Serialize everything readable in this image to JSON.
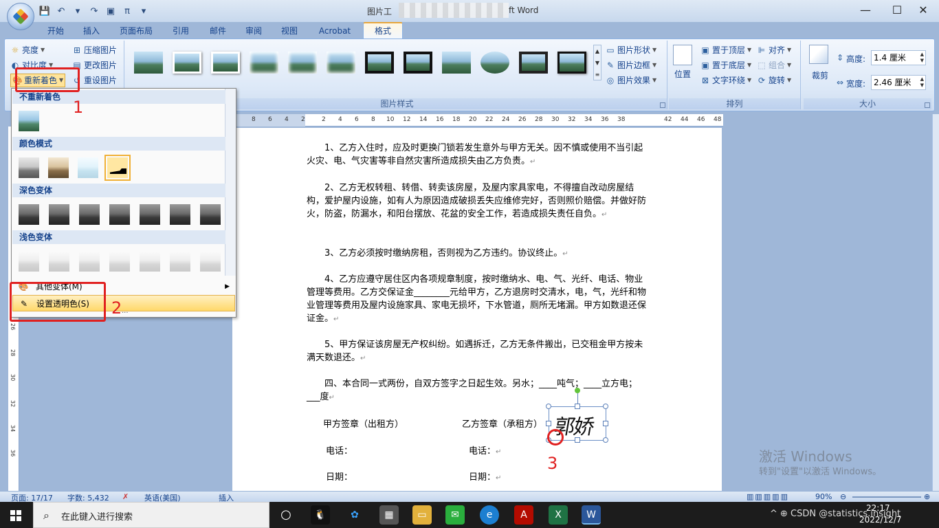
{
  "window": {
    "title_left": "图片工",
    "title_right": "ft Word",
    "controls": [
      "—",
      "☐",
      "✕"
    ]
  },
  "qat": [
    "💾",
    "↶",
    "▾",
    "↷",
    "▣",
    "π",
    "▾"
  ],
  "tabs": [
    "开始",
    "插入",
    "页面布局",
    "引用",
    "邮件",
    "审阅",
    "视图",
    "Acrobat",
    "格式"
  ],
  "ribbon": {
    "adjust": {
      "brightness": "亮度",
      "contrast": "对比度",
      "recolor": "重新着色",
      "compress": "压缩图片",
      "change": "更改图片",
      "reset": "重设图片"
    },
    "styles_label": "图片样式",
    "shape": "图片形状",
    "border": "图片边框",
    "effects": "图片效果",
    "arrange": {
      "position": "位置",
      "front": "置于顶层",
      "back": "置于底层",
      "wrap": "文字环绕",
      "align": "对齐",
      "group": "组合",
      "rotate": "旋转",
      "label": "排列"
    },
    "size": {
      "crop": "裁剪",
      "height_label": "高度:",
      "height_value": "1.4 厘米",
      "width_label": "宽度:",
      "width_value": "2.46 厘米",
      "label": "大小"
    }
  },
  "ruler": {
    "h": [
      "8",
      "6",
      "4",
      "2",
      "2",
      "4",
      "6",
      "8",
      "10",
      "12",
      "14",
      "16",
      "18",
      "20",
      "22",
      "24",
      "26",
      "28",
      "30",
      "32",
      "34",
      "36",
      "38",
      "42",
      "44",
      "46",
      "48"
    ],
    "v": [
      "26",
      "28",
      "30",
      "32",
      "34",
      "36"
    ]
  },
  "recolor_menu": {
    "no_recolor": "不重新着色",
    "color_modes": "颜色模式",
    "dark_variants": "深色变体",
    "light_variants": "浅色变体",
    "more_variants": "其他变体(M)",
    "set_transparent": "设置透明色(S)",
    "partial": "..."
  },
  "document": {
    "p1": "1、乙方入住时，应及时更换门锁若发生意外与甲方无关。因不慎或使用不当引起火灾、电、气灾害等非自然灾害所造成损失由乙方负责。",
    "p2": "2、乙方无权转租、转借、转卖该房屋，及屋内家具家电，不得擅自改动房屋结构，爱护屋内设施，如有人为原因造成破损丢失应维修完好，否则照价赔偿。并做好防火，防盗，防漏水，和阳台摆放、花盆的安全工作，若造成损失责任自负。",
    "p3": "3、乙方必须按时缴纳房租，否则视为乙方违约。协议终止。",
    "p4": "4、乙方应遵守居住区内各项规章制度，按时缴纳水、电、气、光纤、电话、物业管理等费用。乙方交保证金________元给甲方，乙方退房时交清水，电，气，光纤和物业管理等费用及屋内设施家具、家电无损坏，下水管道，厕所无堵漏。甲方如数退还保证金。",
    "p5": "5、甲方保证该房屋无产权纠纷。如遇拆迁，乙方无条件搬出，已交租金甲方按未满天数退还。",
    "p6": "四、本合同一式两份，自双方签字之日起生效。另水；____吨气；____立方电；___度",
    "para_mark": "↵",
    "sign_a": "甲方签章（出租方）",
    "sign_b": "乙方签章（承租方）",
    "phone_a": "电话：",
    "phone_b": "电话：",
    "date_a": "日期：",
    "date_b": "日期：",
    "signature": "郭娇"
  },
  "annotations": [
    "1",
    "2",
    "3"
  ],
  "status": {
    "page": "页面: 17/17",
    "words": "字数: 5,432",
    "lang": "英语(美国)",
    "mode": "插入",
    "zoom": "90%"
  },
  "watermark": {
    "line1": "激活 Windows",
    "line2": "转到\"设置\"以激活 Windows。"
  },
  "taskbar": {
    "search_placeholder": "在此键入进行搜索",
    "tray": "^ ⊕ CSDN @statistics.insight",
    "time": "22:17",
    "date": "2022/12/7"
  }
}
